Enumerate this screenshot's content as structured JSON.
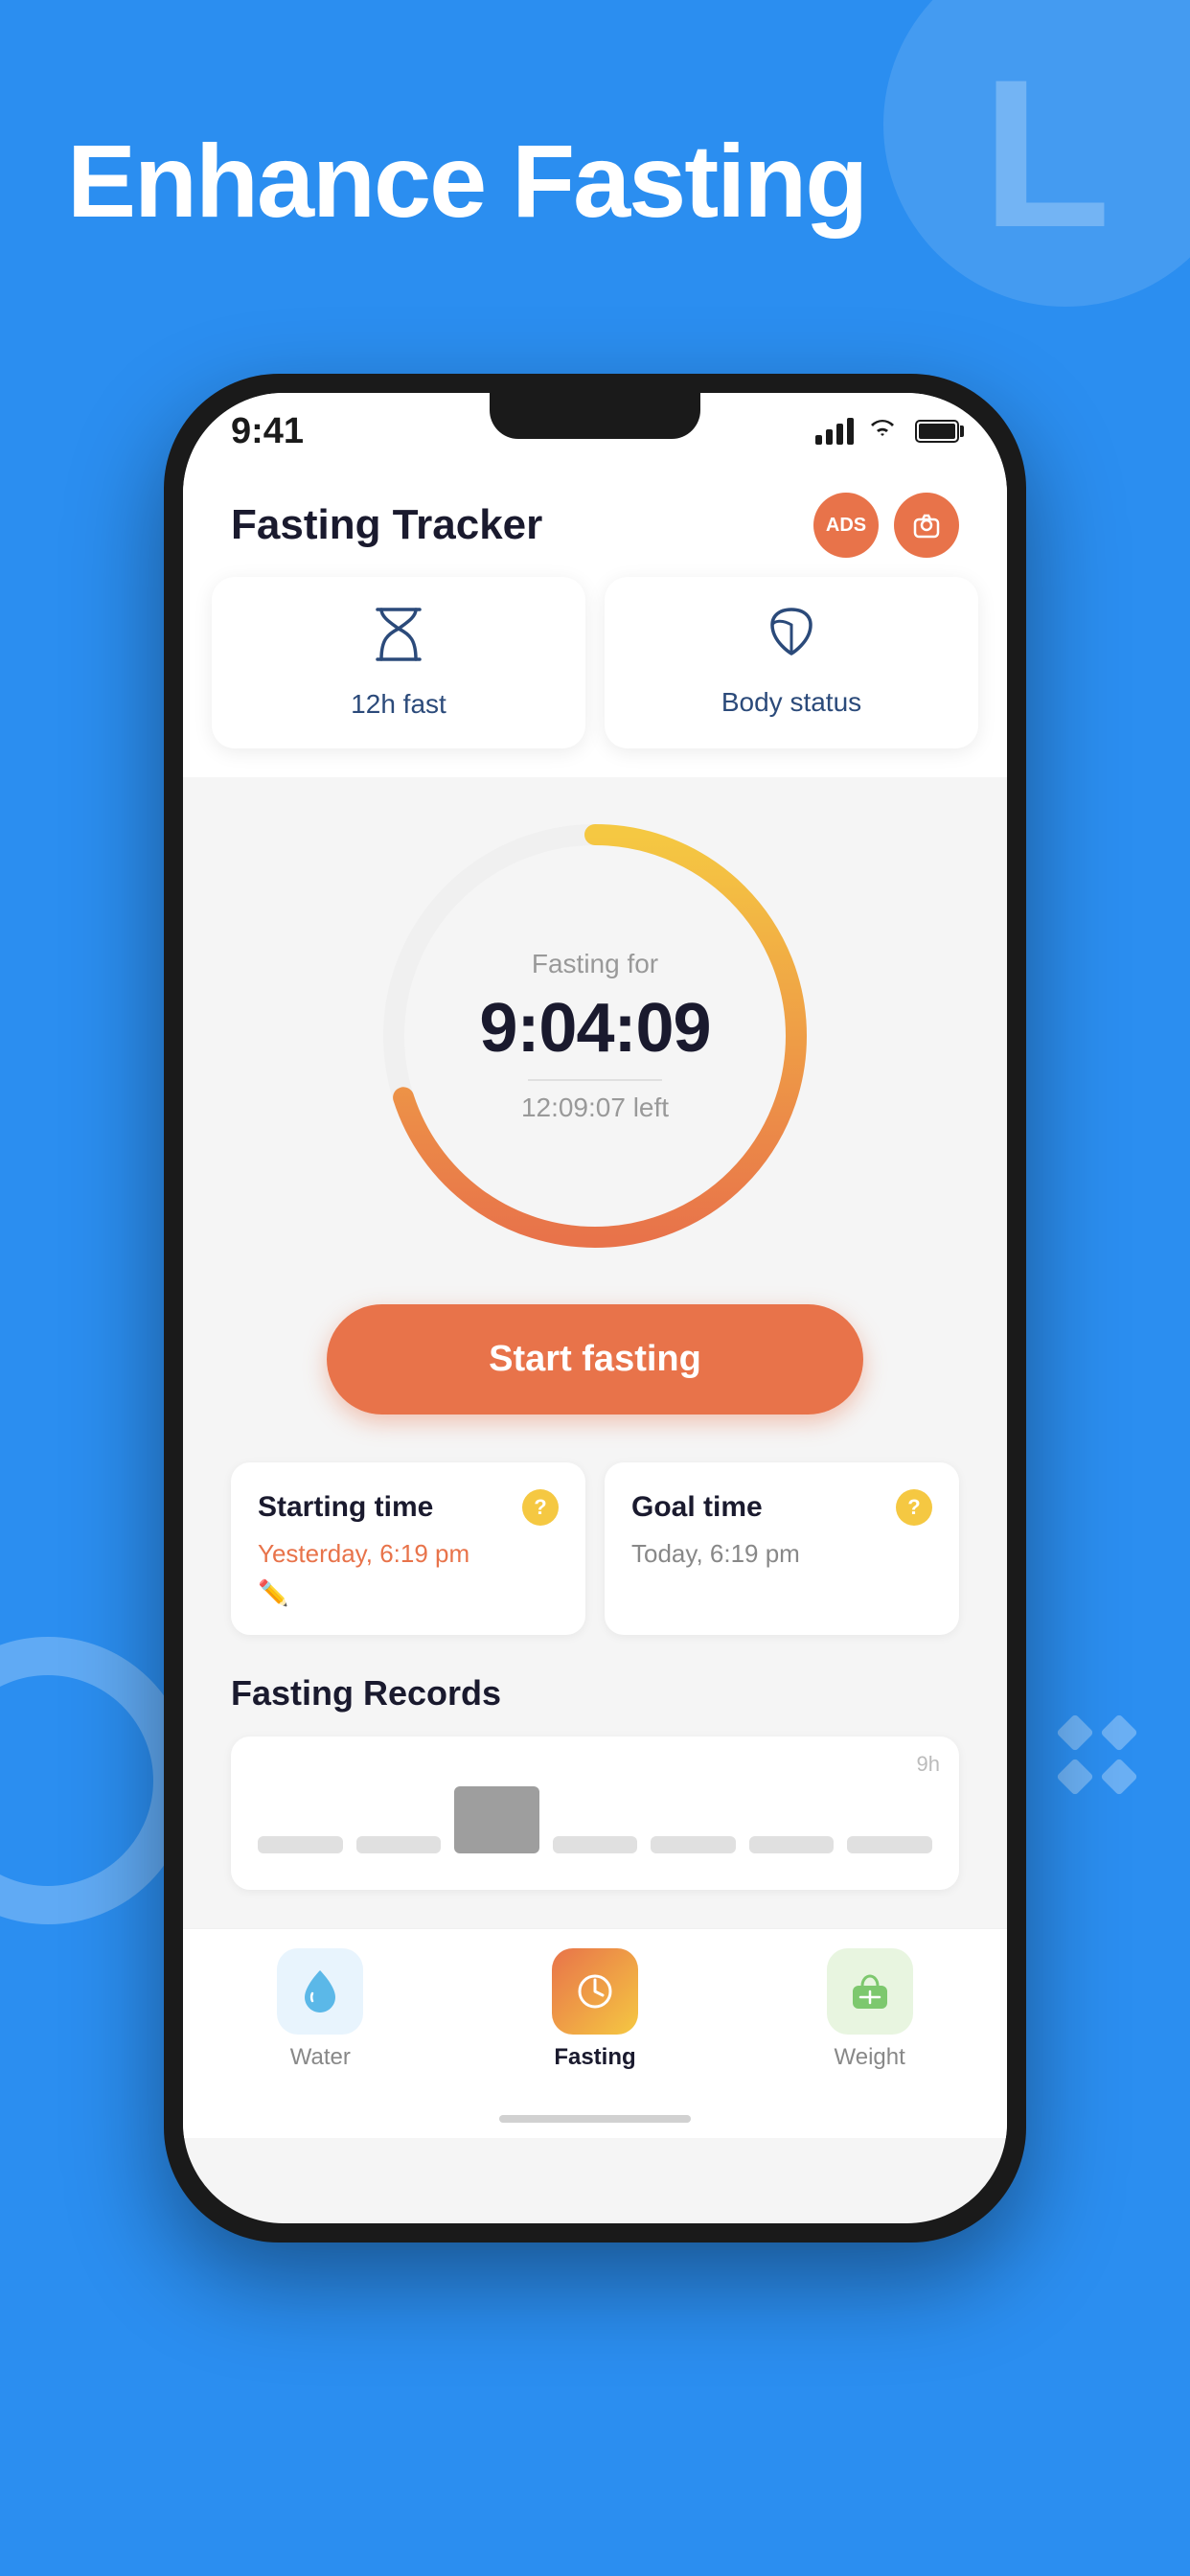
{
  "background": {
    "color": "#2B8EF0"
  },
  "page_title": "Enhance Fasting",
  "status_bar": {
    "time": "9:41",
    "signal": "signal",
    "wifi": "wifi",
    "battery": "battery"
  },
  "app_header": {
    "title": "Fasting Tracker",
    "ads_label": "ADS",
    "camera_label": "camera"
  },
  "tabs": [
    {
      "icon": "hourglass",
      "label": "12h fast"
    },
    {
      "icon": "leaf",
      "label": "Body status"
    }
  ],
  "timer": {
    "label": "Fasting for",
    "value": "9:04:09",
    "remaining": "12:09:07 left"
  },
  "start_button": "Start fasting",
  "time_cards": [
    {
      "title": "Starting time",
      "value": "Yesterday, 6:19 pm",
      "has_edit": true
    },
    {
      "title": "Goal time",
      "value": "Today, 6:19 pm",
      "has_edit": false
    }
  ],
  "records_section": {
    "title": "Fasting Records",
    "chart_label": "9h"
  },
  "bottom_nav": [
    {
      "icon": "water",
      "label": "Water",
      "active": false
    },
    {
      "icon": "fasting",
      "label": "Fasting",
      "active": true
    },
    {
      "icon": "weight",
      "label": "Weight",
      "active": false
    }
  ]
}
